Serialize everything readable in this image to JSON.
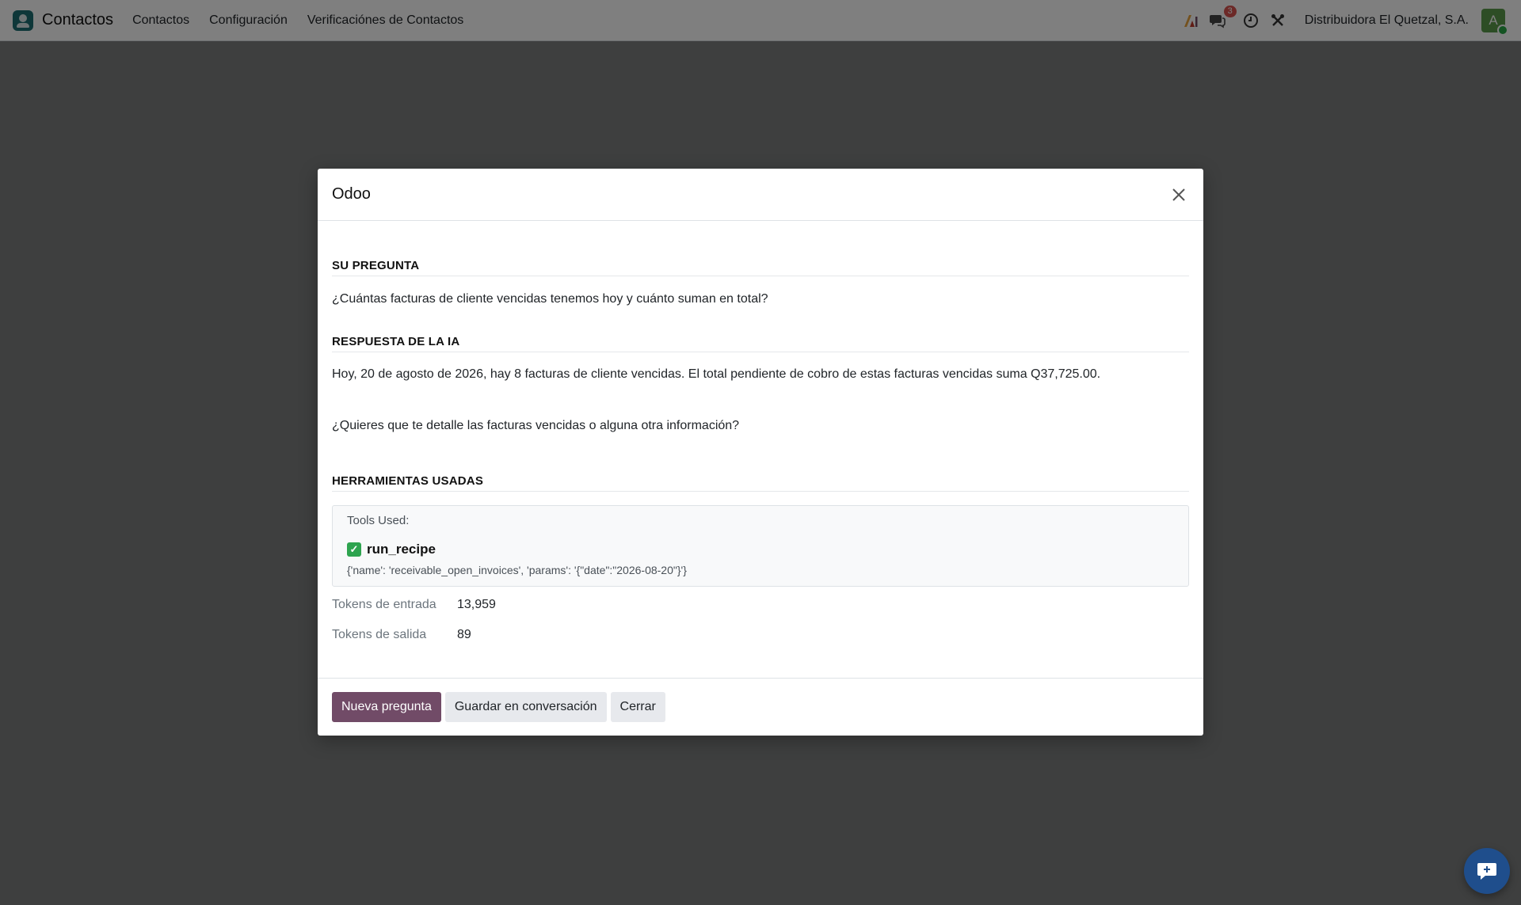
{
  "navbar": {
    "app_name": "Contactos",
    "menu": [
      "Contactos",
      "Configuración",
      "Verificaciónes de Contactos"
    ],
    "messages_badge": "3",
    "company": "Distribuidora El Quetzal, S.A.",
    "avatar_letter": "A"
  },
  "modal": {
    "title": "Odoo",
    "question_heading": "SU PREGUNTA",
    "question_text": "¿Cuántas facturas de cliente vencidas tenemos hoy y cuánto suman en total?",
    "answer_heading": "RESPUESTA DE LA IA",
    "answer_paragraph_1": "Hoy, 20 de agosto de 2026, hay 8 facturas de cliente vencidas. El total pendiente de cobro de estas facturas vencidas suma Q37,725.00.",
    "answer_paragraph_2": "¿Quieres que te detalle las facturas vencidas o alguna otra información?",
    "tools_heading": "HERRAMIENTAS USADAS",
    "tools_caption": "Tools Used:",
    "tool_name": "run_recipe",
    "tool_params": "{'name': 'receivable_open_invoices', 'params': '{\"date\":\"2026-08-20\"}'}",
    "tokens_in_label": "Tokens de entrada",
    "tokens_in_value": "13,959",
    "tokens_out_label": "Tokens de salida",
    "tokens_out_value": "89"
  },
  "footer": {
    "new_question": "Nueva pregunta",
    "save_conversation": "Guardar en conversación",
    "close": "Cerrar"
  },
  "colors": {
    "primary": "#714b67",
    "check": "#2ea44f",
    "chat_fab": "#1f4e8c"
  }
}
